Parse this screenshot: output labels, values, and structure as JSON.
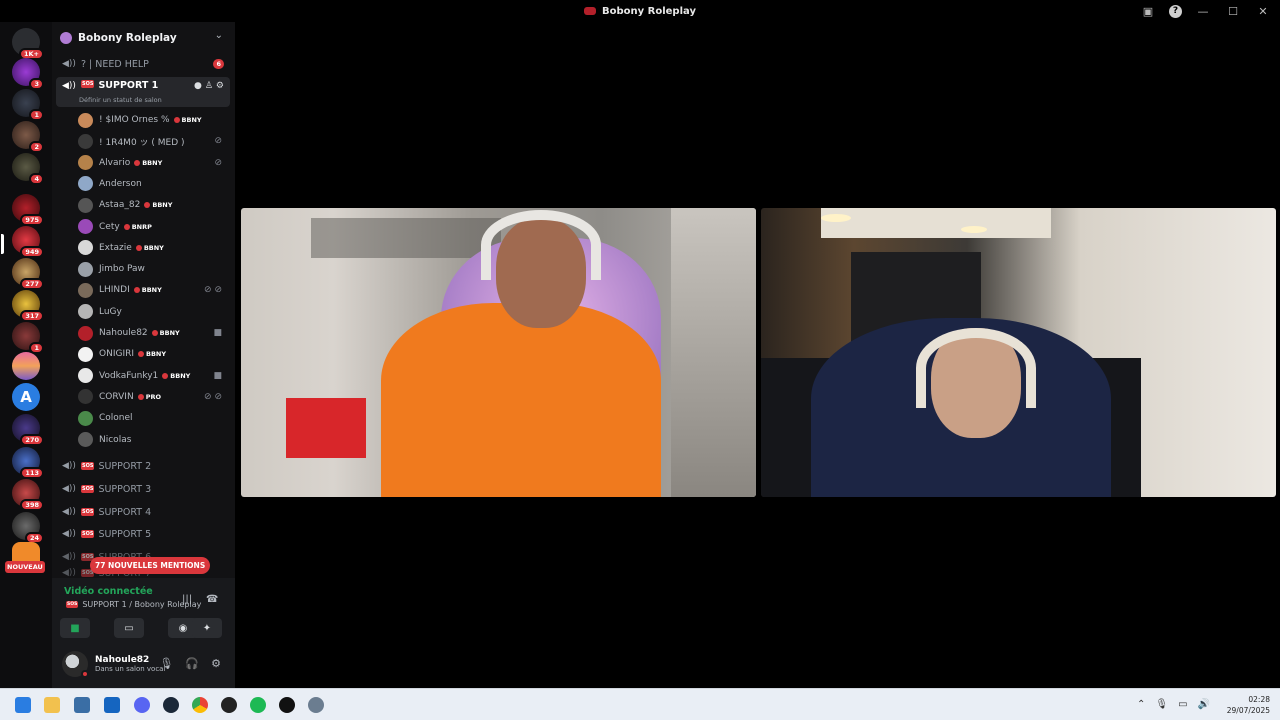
{
  "window": {
    "title": "Bobony Roleplay"
  },
  "rail": {
    "top_badge": "1K+",
    "badges": [
      "3",
      "1",
      "2",
      "4",
      "975",
      "949",
      "277",
      "317",
      "1",
      "270",
      "113",
      "398",
      "24"
    ],
    "new_label": "NOUVEAU"
  },
  "server": {
    "name": "Bobony Roleplay"
  },
  "channels": {
    "need_help": {
      "label": "NEED HELP",
      "prefix": "? |",
      "badge": "6"
    },
    "support1": {
      "label": "SUPPORT 1",
      "status": "Définir un statut de salon"
    },
    "others": [
      "SUPPORT 2",
      "SUPPORT 3",
      "SUPPORT 4",
      "SUPPORT 5",
      "SUPPORT 6",
      "SUPPORT 7"
    ]
  },
  "members": [
    {
      "name": "! $IMO Ornes %",
      "tag": "BBNY"
    },
    {
      "name": "! 1R4M0 ッ ( MED )",
      "tag": ""
    },
    {
      "name": "Alvario",
      "tag": "BBNY"
    },
    {
      "name": "Anderson",
      "tag": ""
    },
    {
      "name": "Astaa_82",
      "tag": "BBNY"
    },
    {
      "name": "Cety",
      "tag": "BNRP"
    },
    {
      "name": "Extazie",
      "tag": "BBNY"
    },
    {
      "name": "Jimbo Paw",
      "tag": ""
    },
    {
      "name": "LHINDI",
      "tag": "BBNY"
    },
    {
      "name": "LuGy",
      "tag": ""
    },
    {
      "name": "Nahoule82",
      "tag": "BBNY"
    },
    {
      "name": "ONIGIRI",
      "tag": "BBNY"
    },
    {
      "name": "VodkaFunky1",
      "tag": "BBNY"
    },
    {
      "name": "CORVIN",
      "tag": "PRO"
    },
    {
      "name": "Colonel",
      "tag": ""
    },
    {
      "name": "Nicolas",
      "tag": ""
    }
  ],
  "mentions": "77 NOUVELLES MENTIONS",
  "voice": {
    "status": "Vidéo connectée",
    "channel": "SUPPORT 1 / Bobony Roleplay"
  },
  "me": {
    "name": "Nahoule82",
    "sub": "Dans un salon vocal"
  },
  "clock": {
    "time": "02:28",
    "date": "29/07/2025"
  },
  "colors": {
    "accent_red": "#da373c",
    "connected_green": "#23a55a"
  }
}
